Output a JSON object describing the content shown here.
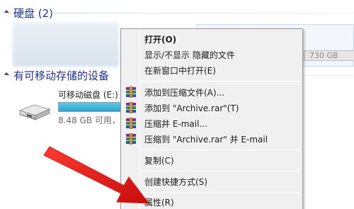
{
  "explorer": {
    "section_hdd": "硬盘 (2)",
    "section_removable": "有可移动存储的设备",
    "drive_right": {
      "free_text": "730 GB"
    },
    "usb": {
      "name": "可移动磁盘 (E:)",
      "free": "8.48 GB 可用，",
      "used_percent": 100
    }
  },
  "context_menu": {
    "items": [
      {
        "label": "打开(O)",
        "bold": true,
        "icon": ""
      },
      {
        "label": "显示/不显示 隐藏的文件",
        "icon": ""
      },
      {
        "label": "在新窗口中打开(E)",
        "icon": ""
      },
      {
        "label": "添加到压缩文件(A)...",
        "icon": "winrar-icon"
      },
      {
        "label": "添加到 \"Archive.rar\"(T)",
        "icon": "winrar-icon"
      },
      {
        "label": "压缩并 E-mail...",
        "icon": "winrar-icon"
      },
      {
        "label": "压缩到 \"Archive.rar\" 并 E-mail",
        "icon": "winrar-icon"
      },
      {
        "label": "复制(C)",
        "icon": ""
      },
      {
        "label": "创建快捷方式(S)",
        "icon": ""
      },
      {
        "label": "属性(R)",
        "icon": ""
      }
    ]
  },
  "colors": {
    "section_text": "#1e3287",
    "arrow": "#e0191a",
    "usb_fill": "#2aa3cf"
  }
}
